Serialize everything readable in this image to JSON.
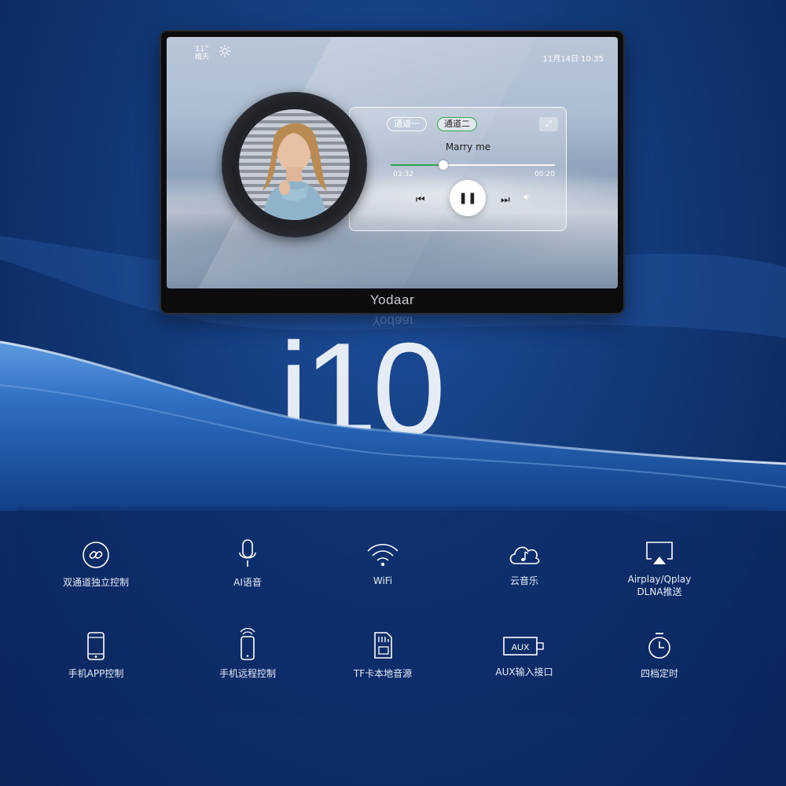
{
  "screen": {
    "temperature": "11°",
    "weather": "晴天",
    "datetime": "11月14日 10:35"
  },
  "player": {
    "channel_1": "通道一",
    "channel_2": "通道二",
    "song_title": "Marry me",
    "elapsed": "03:32",
    "remaining": "00:20",
    "progress_fraction": 0.32
  },
  "brand": "Yodaar",
  "model": "i10",
  "features": [
    {
      "label": "双通道独立控制",
      "icon": "link-icon"
    },
    {
      "label": "AI语音",
      "icon": "microphone-icon"
    },
    {
      "label": "WiFi",
      "icon": "wifi-icon"
    },
    {
      "label": "云音乐",
      "icon": "cloud-music-icon"
    },
    {
      "label": "Airplay/Qplay",
      "label2": "DLNA推送",
      "icon": "airplay-icon"
    },
    {
      "label": "手机APP控制",
      "icon": "phone-icon"
    },
    {
      "label": "手机远程控制",
      "icon": "remote-phone-icon"
    },
    {
      "label": "TF卡本地音源",
      "icon": "sd-card-icon"
    },
    {
      "label": "AUX输入接口",
      "icon": "aux-port-icon",
      "icon_text": "AUX"
    },
    {
      "label": "四档定时",
      "icon": "timer-icon"
    }
  ]
}
